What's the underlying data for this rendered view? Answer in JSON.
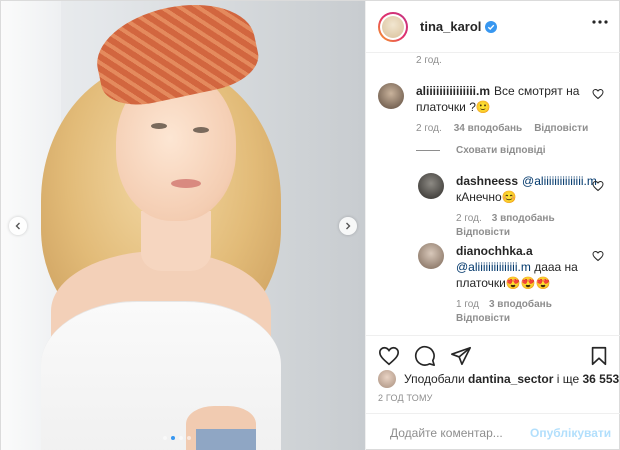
{
  "header": {
    "username": "tina_karol",
    "verified_icon": "verified-badge-icon",
    "more_icon": "more-options-icon"
  },
  "caption": {
    "time": "2 год."
  },
  "comments": [
    {
      "username": "aliiiiiiiiiiiiiii.m",
      "text": "Все смотрят на платочки ?🙂",
      "time": "2 год.",
      "likes": "34 вподобань",
      "reply": "Відповісти"
    }
  ],
  "hide_replies": "Сховати відповіді",
  "replies": [
    {
      "username": "dashneess",
      "mention": "@aliiiiiiiiiiiiiii.m",
      "text": "кАнечно😊",
      "time": "2 год.",
      "likes": "3 вподобань",
      "reply": "Відповісти"
    },
    {
      "username": "dianochhka.a",
      "mention": "@aliiiiiiiiiiiiiii.m",
      "text": "дааа на платочки😍😍😍",
      "time": "1 год",
      "likes": "3 вподобань",
      "reply": "Відповісти"
    }
  ],
  "likes_summary": {
    "prefix": "Уподобали",
    "user": "dantina_sector",
    "middle": "і ще",
    "count": "36 553"
  },
  "post_time": "2 ГОД ТОМУ",
  "comment_box": {
    "placeholder": "Додайте коментар...",
    "publish": "Опублікувати"
  },
  "colors": {
    "link_blue": "#00376b",
    "verified_blue": "#3897f0",
    "publish_disabled": "#b2dffc",
    "muted": "#8e8e8e"
  }
}
